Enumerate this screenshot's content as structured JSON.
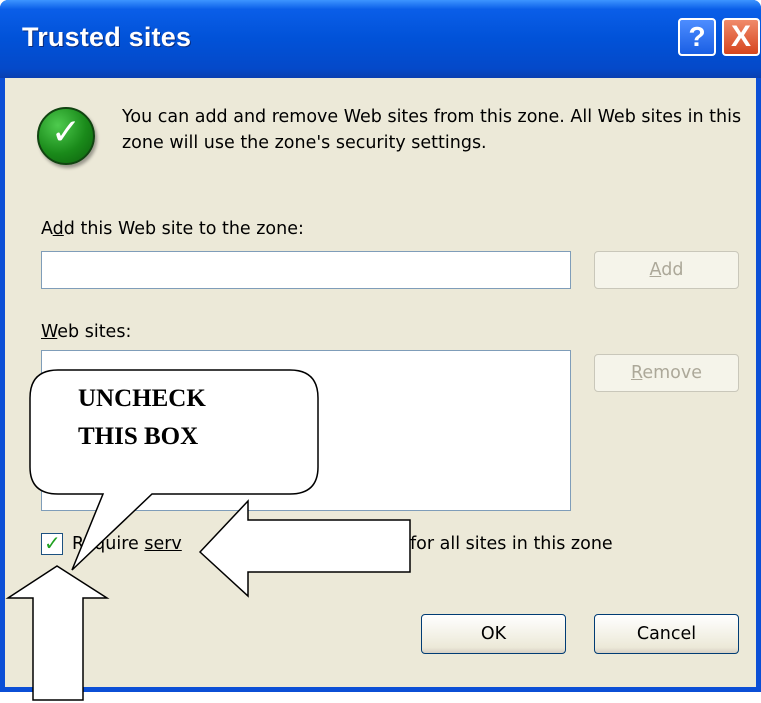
{
  "dialog": {
    "title": "Trusted sites",
    "help_symbol": "?",
    "close_symbol": "X",
    "info_text": "You can add and remove Web sites from this zone. All Web sites in this zone will use the zone's security settings.",
    "add_label_pre": "A",
    "add_label_u": "d",
    "add_label_post": "d this Web site to the zone:",
    "add_input_value": "",
    "add_button_u": "A",
    "add_button_post": "dd",
    "sites_label_u": "W",
    "sites_label_post": "eb sites:",
    "sites_list": [],
    "remove_button_u": "R",
    "remove_button_post": "emove",
    "checkbox_checked": true,
    "checkbox_label_pre": "Require ",
    "checkbox_label_u": "serv",
    "checkbox_label_post": "for all sites in this zone",
    "ok_label": "OK",
    "cancel_label": "Cancel"
  },
  "annotation": {
    "callout_line1": "UNCHECK",
    "callout_line2": "THIS BOX"
  },
  "icons": {
    "info": "green-checkmark-icon",
    "checkbox_mark": "checkmark-icon"
  },
  "colors": {
    "titlebar": "#0152d8",
    "client": "#ece9d8",
    "check_green": "#21a121"
  }
}
